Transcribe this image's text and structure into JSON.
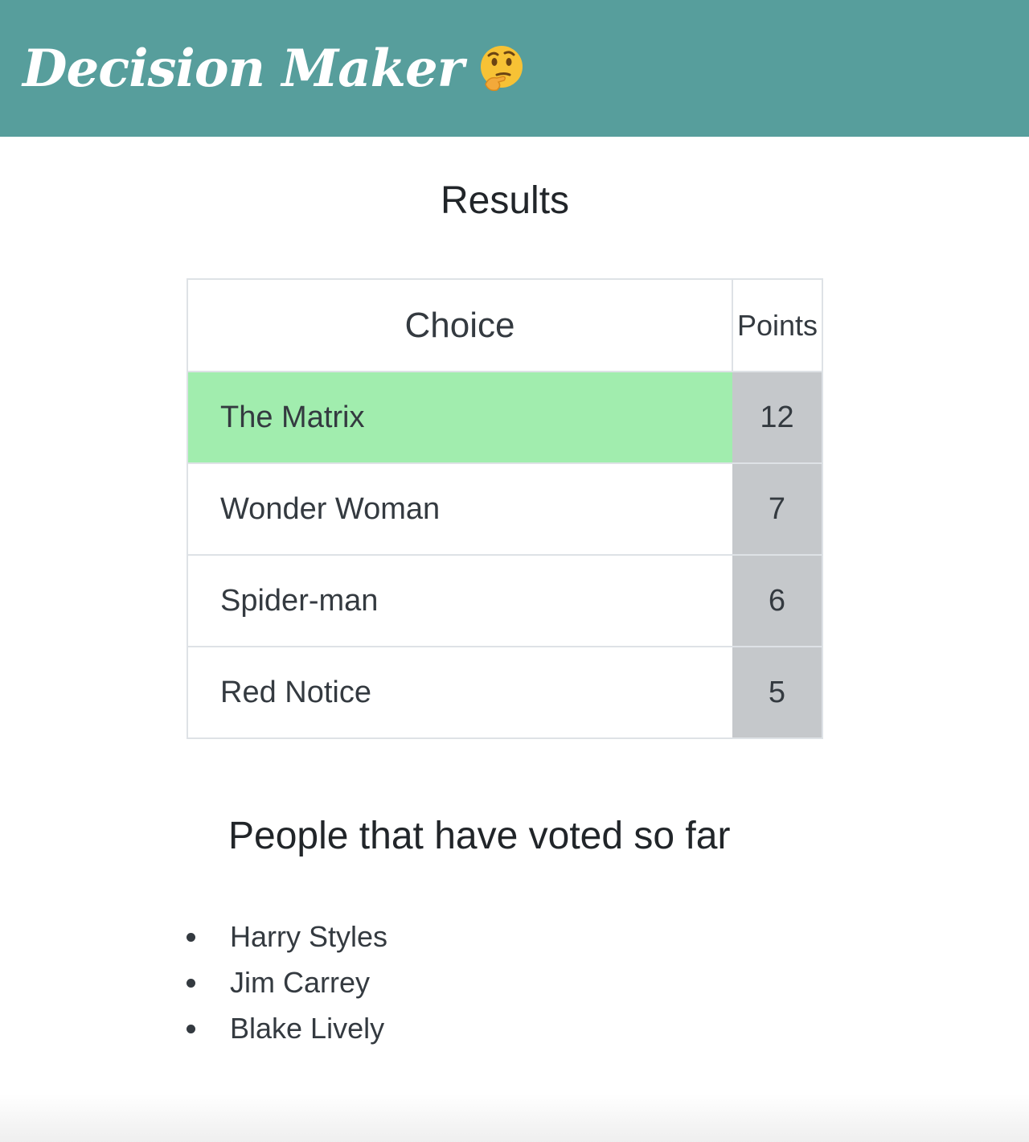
{
  "header": {
    "title": "Decision Maker",
    "emoji_icon": "thinking-face-icon",
    "background_color": "#579e9c"
  },
  "results": {
    "title": "Results",
    "columns": [
      "Choice",
      "Points"
    ],
    "winner_color": "#a1edae",
    "points_color": "#c5c8cb",
    "rows": [
      {
        "choice": "The Matrix",
        "points": "12"
      },
      {
        "choice": "Wonder Woman",
        "points": "7"
      },
      {
        "choice": "Spider-man",
        "points": "6"
      },
      {
        "choice": "Red Notice",
        "points": "5"
      }
    ]
  },
  "voters": {
    "title": "People that have voted so far",
    "people": [
      "Harry Styles",
      "Jim Carrey",
      "Blake Lively"
    ]
  }
}
